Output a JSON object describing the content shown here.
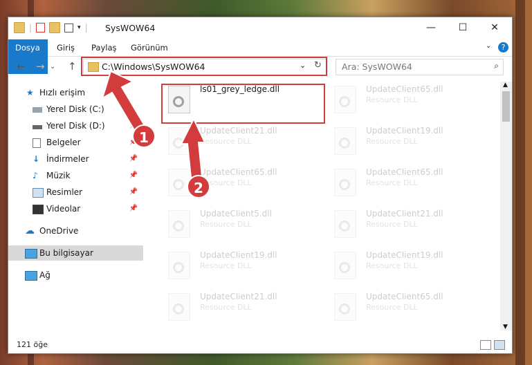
{
  "window": {
    "title": "SysWOW64",
    "controls": [
      "—",
      "☐",
      "✕"
    ]
  },
  "ribbon": {
    "tabs": [
      "Dosya",
      "Giriş",
      "Paylaş",
      "Görünüm"
    ],
    "help": "?"
  },
  "address": {
    "path": "C:\\Windows\\SysWOW64",
    "search_placeholder": "Ara: SysWOW64"
  },
  "nav": {
    "items": [
      {
        "label": "Hızlı erişim",
        "icon": "star-icon"
      },
      {
        "label": "Yerel Disk (C:)",
        "icon": "drive-icon"
      },
      {
        "label": "Yerel Disk (D:)",
        "icon": "drive-icon"
      },
      {
        "label": "Belgeler",
        "icon": "document-icon"
      },
      {
        "label": "İndirmeler",
        "icon": "download-icon"
      },
      {
        "label": "Müzik",
        "icon": "music-icon"
      },
      {
        "label": "Resimler",
        "icon": "picture-icon"
      },
      {
        "label": "Videolar",
        "icon": "video-icon"
      },
      {
        "label": "OneDrive",
        "icon": "cloud-icon"
      },
      {
        "label": "Bu bilgisayar",
        "icon": "computer-icon"
      },
      {
        "label": "Ağ",
        "icon": "network-icon"
      }
    ]
  },
  "files": [
    {
      "name": "ls01_grey_ledge.dll",
      "type": ""
    },
    {
      "name": "UpdateClient65.dll",
      "type": "Resource DLL"
    },
    {
      "name": "UpdateClient21.dll",
      "type": "Resource DLL"
    },
    {
      "name": "UpdateClient19.dll",
      "type": "Resource DLL"
    },
    {
      "name": "UpdateClient65.dll",
      "type": "Resource DLL"
    },
    {
      "name": "UpdateClient65.dll",
      "type": "Resource DLL"
    },
    {
      "name": "UpdateClient5.dll",
      "type": "Resource DLL"
    },
    {
      "name": "UpdateClient21.dll",
      "type": "Resource DLL"
    },
    {
      "name": "UpdateClient19.dll",
      "type": "Resource DLL"
    },
    {
      "name": "UpdateClient19.dll",
      "type": "Resource DLL"
    },
    {
      "name": "UpdateClient21.dll",
      "type": "Resource DLL"
    },
    {
      "name": "UpdateClient65.dll",
      "type": "Resource DLL"
    }
  ],
  "status": {
    "count": "121 öğe"
  },
  "callouts": [
    "1",
    "2"
  ],
  "colors": {
    "accent": "#1979ca",
    "highlight": "#d33c3c"
  }
}
